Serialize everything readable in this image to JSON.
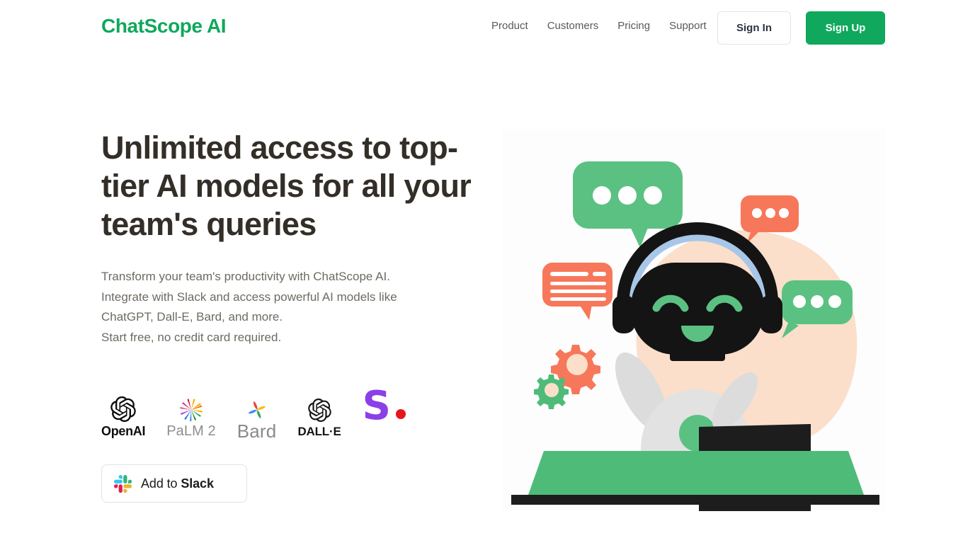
{
  "header": {
    "brand": "ChatScope AI",
    "nav": [
      {
        "label": "Product"
      },
      {
        "label": "Customers"
      },
      {
        "label": "Pricing"
      },
      {
        "label": "Support"
      }
    ],
    "sign_in_label": "Sign In",
    "sign_up_label": "Sign Up"
  },
  "hero": {
    "headline": "Unlimited access to top-tier AI models for all your team's queries",
    "subcopy_lines": [
      "Transform your team's productivity with ChatScope AI.",
      "Integrate with Slack and access powerful AI models like",
      "ChatGPT, Dall-E, Bard, and more.",
      "Start free, no credit card required."
    ],
    "logos": [
      {
        "name": "openai",
        "label": "OpenAI"
      },
      {
        "name": "palm2",
        "label": "PaLM 2"
      },
      {
        "name": "bard",
        "label": "Bard"
      },
      {
        "name": "dalle",
        "label": "DALL·E"
      },
      {
        "name": "stability",
        "label": "S."
      }
    ],
    "cta": {
      "icon": "slack-icon",
      "label_prefix": "Add to ",
      "label_brand": "Slack"
    },
    "illustration": {
      "alt": "robot with headphones at a desk surrounded by chat bubbles",
      "elements": [
        "peach-blob",
        "green-chat-bubble-large",
        "orange-chat-bubble-small",
        "orange-message-bubble-lines",
        "green-chat-bubble-right",
        "robot",
        "laptop",
        "desk",
        "gear-orange",
        "gear-green"
      ]
    }
  },
  "colors": {
    "brand_green": "#0FA85C",
    "illustration_green": "#5BC183",
    "illustration_orange": "#F7775A",
    "peach_blob": "#FBDFCB",
    "desk_green": "#4FBB79",
    "robot_body": "#E2E2E2",
    "dark": "#1D1D1D",
    "headline": "#332E27",
    "body_text": "#6E6A63",
    "stability_purple": "#8B3FE8",
    "stability_dot_red": "#E8151D"
  }
}
